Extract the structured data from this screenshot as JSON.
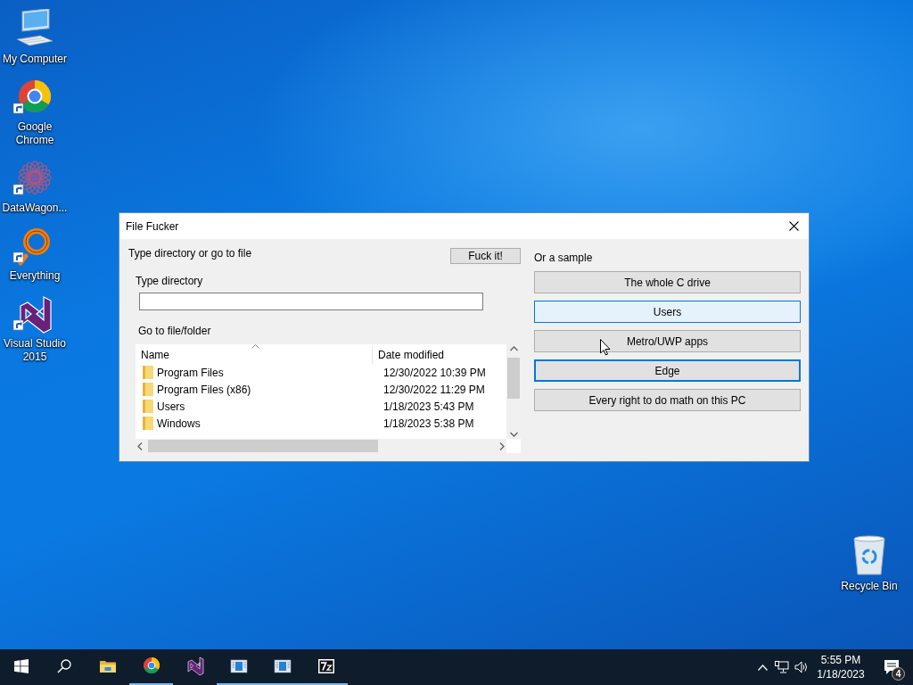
{
  "desktop_icons": [
    {
      "label": "My Computer",
      "kind": "computer",
      "shortcut": false
    },
    {
      "label": "Google Chrome",
      "kind": "chrome",
      "shortcut": true
    },
    {
      "label": "DataWagon...",
      "kind": "datawagon",
      "shortcut": true
    },
    {
      "label": "Everything",
      "kind": "everything",
      "shortcut": true
    },
    {
      "label": "Visual Studio 2015",
      "kind": "vs",
      "shortcut": true
    }
  ],
  "recycle_bin": {
    "label": "Recycle Bin"
  },
  "window": {
    "title": "File Fucker",
    "left": {
      "heading": "Type directory or go to file",
      "go_button": "Fuck it!",
      "directory_label": "Type directory",
      "list_label": "Go to file/folder",
      "columns": [
        "Name",
        "Date modified"
      ],
      "rows": [
        {
          "name": "Program Files",
          "date": "12/30/2022 10:39 PM"
        },
        {
          "name": "Program Files (x86)",
          "date": "12/30/2022 11:29 PM"
        },
        {
          "name": "Users",
          "date": "1/18/2023 5:43 PM"
        },
        {
          "name": "Windows",
          "date": "1/18/2023 5:38 PM"
        }
      ]
    },
    "samples": {
      "heading": "Or a sample",
      "buttons": [
        {
          "label": "The whole C drive",
          "hovered": false,
          "focused": false
        },
        {
          "label": "Users",
          "hovered": true,
          "focused": false
        },
        {
          "label": "Metro/UWP apps",
          "hovered": false,
          "focused": false
        },
        {
          "label": "Edge",
          "hovered": false,
          "focused": true
        },
        {
          "label": "Every right to do math on this PC",
          "hovered": false,
          "focused": false
        }
      ]
    }
  },
  "taskbar": {
    "apps": [
      {
        "kind": "explorer",
        "running": false
      },
      {
        "kind": "chrome",
        "running": true
      },
      {
        "kind": "vs",
        "running": false
      },
      {
        "kind": "window",
        "running": true
      },
      {
        "kind": "window",
        "running": true
      },
      {
        "kind": "sevenzip",
        "running": true
      }
    ],
    "clock": {
      "time": "5:55 PM",
      "date": "1/18/2023"
    },
    "notifications": {
      "count": "4"
    }
  }
}
